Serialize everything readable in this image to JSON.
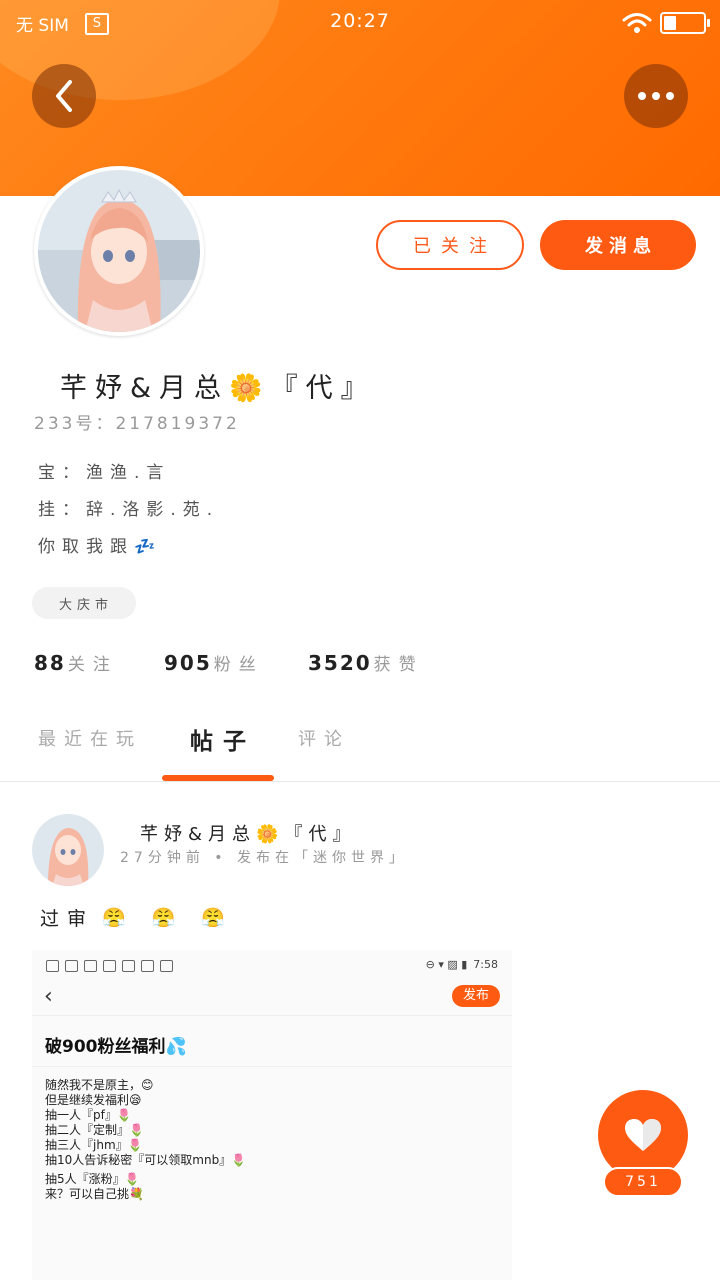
{
  "status_bar": {
    "carrier": "无 SIM",
    "sim_icon_label": "S",
    "time": "20:27",
    "icons": [
      "wifi-icon",
      "battery-icon"
    ]
  },
  "header": {
    "back_icon": "chevron-left-icon",
    "more_icon": "more-dots-icon"
  },
  "profile": {
    "follow_label": "已关注",
    "message_label": "发消息",
    "username": "芊妤&月总🌼『代』",
    "uid": "233号：217819372",
    "bio": [
      "宝：渔渔.言",
      "挂：辞.洛影.苑.",
      "你取我跟💤"
    ],
    "location": "大庆市",
    "stats": {
      "following_count": "88",
      "following_label": "关注",
      "fans_count": "905",
      "fans_label": "粉丝",
      "likes_count": "3520",
      "likes_label": "获赞"
    }
  },
  "tabs": [
    {
      "label": "最近在玩",
      "active": false
    },
    {
      "label": "帖子",
      "active": true
    },
    {
      "label": "评论",
      "active": false
    }
  ],
  "post": {
    "author": "芊妤&月总🌼『代』",
    "meta": "27分钟前 • 发布在「迷你世界」",
    "text": "过审",
    "emojis": [
      "😤",
      "😤",
      "😤"
    ],
    "embedded_screenshot": {
      "time": "7:58",
      "publish_label": "发布",
      "title": "破900粉丝福利💦",
      "lines": [
        "随然我不是原主，😊",
        "但是继续发福利😪",
        "抽一人『pf』🌷",
        "抽二人『定制』🌷",
        "抽三人『jhm』🌷",
        "抽10人告诉秘密『可以领取mnb』🌷",
        "抽5人『涨粉』🌷",
        "来？可以自己挑💐"
      ]
    }
  },
  "like": {
    "count": "751",
    "icon": "heart-icon"
  },
  "colors": {
    "accent": "#ff5a12",
    "header_gradient_start": "#ff8a1f",
    "header_gradient_end": "#ff6a00"
  }
}
